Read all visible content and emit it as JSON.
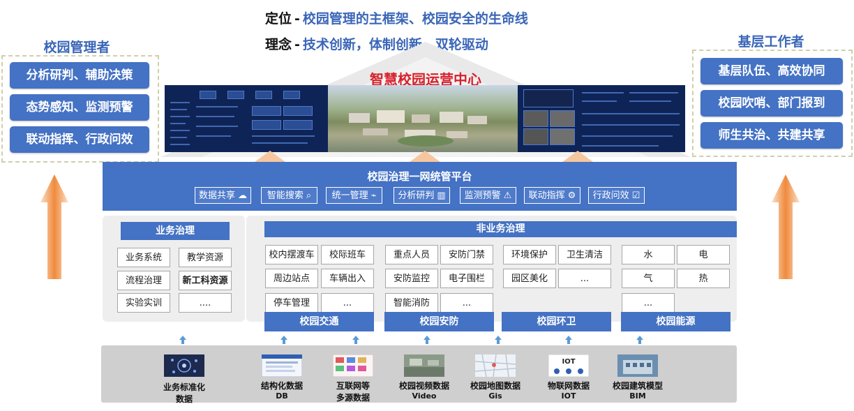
{
  "header": {
    "line1": {
      "key": "定位",
      "sep": "-",
      "value": "校园管理的主框架、校园安全的生命线"
    },
    "line2": {
      "key": "理念",
      "sep": "-",
      "value": "技术创新，体制创新，双轮驱动"
    }
  },
  "center_title": "智慧校园运营中心",
  "left_panel": {
    "title": "校园管理者",
    "items": [
      "分析研判、辅助决策",
      "态势感知、监测预警",
      "联动指挥、行政问效"
    ]
  },
  "right_panel": {
    "title": "基层工作者",
    "items": [
      "基层队伍、高效协同",
      "校园吹哨、部门报到",
      "师生共治、共建共享"
    ]
  },
  "platform": {
    "title": "校园治理一网统管平台",
    "features": [
      {
        "label": "数据共享",
        "icon": "cloud-share-icon",
        "glyph": "☁"
      },
      {
        "label": "智能搜索",
        "icon": "search-icon",
        "glyph": "⌕"
      },
      {
        "label": "统一管理",
        "icon": "pulse-icon",
        "glyph": "⌁"
      },
      {
        "label": "分析研判",
        "icon": "chart-icon",
        "glyph": "▥"
      },
      {
        "label": "监测预警",
        "icon": "alarm-icon",
        "glyph": "⚠"
      },
      {
        "label": "联动指挥",
        "icon": "network-icon",
        "glyph": "⚙"
      },
      {
        "label": "行政问效",
        "icon": "check-icon",
        "glyph": "☑"
      }
    ]
  },
  "business": {
    "title": "业务治理",
    "cells": [
      "业务系统",
      "教学资源",
      "流程治理",
      "新工科资源",
      "实验实训",
      "...."
    ]
  },
  "nonbusiness": {
    "title": "非业务治理",
    "groups": [
      {
        "name": "校园交通",
        "cells": [
          "校内摆渡车",
          "校际班车",
          "周边站点",
          "车辆出入",
          "停车管理",
          "..."
        ]
      },
      {
        "name": "校园安防",
        "cells": [
          "重点人员",
          "安防门禁",
          "安防监控",
          "电子围栏",
          "智能消防",
          "..."
        ]
      },
      {
        "name": "校园环卫",
        "cells": [
          "环境保护",
          "卫生清洁",
          "园区美化",
          "..."
        ]
      },
      {
        "name": "校园能源",
        "cells": [
          "水",
          "电",
          "气",
          "热",
          "..."
        ]
      }
    ]
  },
  "data_sources": [
    {
      "line1": "业务标准化",
      "line2": "数据",
      "icon": "standard-data-icon"
    },
    {
      "line1": "结构化数据",
      "line2": "DB",
      "icon": "database-icon"
    },
    {
      "line1": "互联网等",
      "line2": "多源数据",
      "icon": "internet-icon"
    },
    {
      "line1": "校园视频数据",
      "line2": "Video",
      "icon": "video-icon"
    },
    {
      "line1": "校园地图数据",
      "line2": "Gis",
      "icon": "map-icon"
    },
    {
      "line1": "物联网数据",
      "line2": "IOT",
      "icon": "iot-icon"
    },
    {
      "line1": "校园建筑模型",
      "line2": "BIM",
      "icon": "bim-icon"
    }
  ],
  "iot_thumb_text": "IOT",
  "colors": {
    "primary": "#4472c4",
    "accent_red": "#d8202a",
    "title_blue": "#3a66b8",
    "arrow_orange": "#f4a261"
  }
}
